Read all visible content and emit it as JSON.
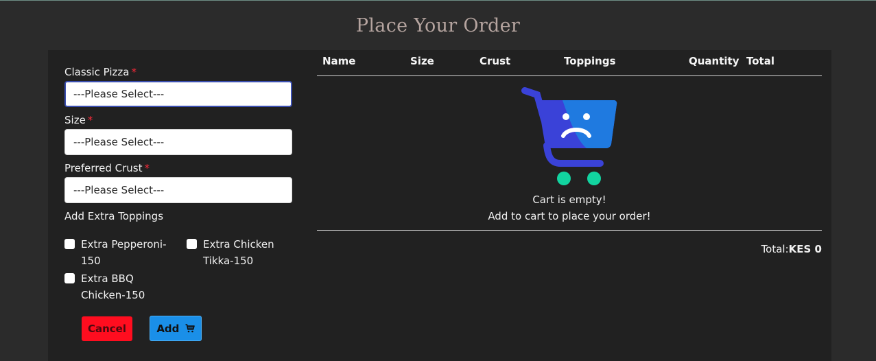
{
  "page": {
    "title": "Place Your Order"
  },
  "form": {
    "pizza": {
      "label": "Classic Pizza",
      "required_mark": "*",
      "value": "---Please Select---"
    },
    "size": {
      "label": "Size",
      "required_mark": "*",
      "value": "---Please Select---"
    },
    "crust": {
      "label": "Preferred Crust",
      "required_mark": "*",
      "value": "---Please Select---"
    },
    "toppings": {
      "label": "Add Extra Toppings",
      "items": [
        {
          "line1": "Extra Pepperoni-",
          "line2": "150",
          "checked": false
        },
        {
          "line1": "Extra Chicken",
          "line2": "Tikka-150",
          "checked": false
        },
        {
          "line1": "Extra BBQ",
          "line2": "Chicken-150",
          "checked": false
        }
      ]
    },
    "cancel_label": "Cancel",
    "add_label": "Add",
    "add_icon": "cart-icon"
  },
  "cart": {
    "columns": [
      "Name",
      "Size",
      "Crust",
      "Toppings",
      "Quantity",
      "Total"
    ],
    "empty_icon": "sad-cart-icon",
    "empty_title": "Cart is empty!",
    "empty_subtitle": "Add to cart to place your order!",
    "total_label": "Total:",
    "total_value": "KES 0"
  },
  "colors": {
    "title": "#b5a49f",
    "cart_blue": "#3a42d8",
    "cart_light_blue": "#1f7ae0",
    "cart_wheels": "#12d4a0",
    "cancel": "#ff0d1f",
    "add": "#1a8fe8",
    "required": "#ff2a3a"
  }
}
